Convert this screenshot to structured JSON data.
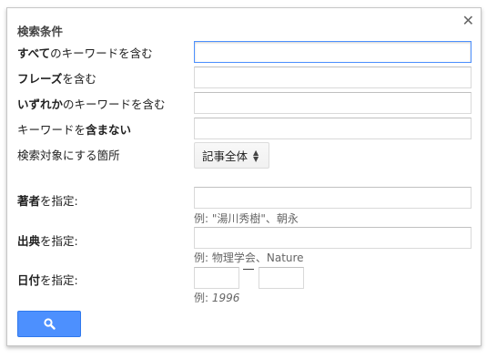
{
  "dialog": {
    "title": "検索条件",
    "close_glyph": "✕"
  },
  "fields": {
    "all_words": {
      "label_bold": "すべて",
      "label_rest": "のキーワードを含む",
      "value": ""
    },
    "phrase": {
      "label_bold": "フレーズ",
      "label_rest": "を含む",
      "value": ""
    },
    "any_words": {
      "label_bold": "いずれか",
      "label_rest": "のキーワードを含む",
      "value": ""
    },
    "exclude": {
      "label_pre": "キーワードを",
      "label_bold": "含まない",
      "value": ""
    },
    "target": {
      "label": "検索対象にする箇所",
      "selected": "記事全体",
      "arrows": "▲▼"
    },
    "author": {
      "label_bold": "著者",
      "label_rest": "を指定:",
      "value": "",
      "example": "例: \"湯川秀樹\"、朝永"
    },
    "source": {
      "label_bold": "出典",
      "label_rest": "を指定:",
      "value": "",
      "example": "例: 物理学会、Nature"
    },
    "date": {
      "label_bold": "日付",
      "label_rest": "を指定:",
      "from": "",
      "to": "",
      "example_prefix": "例: ",
      "example_value": "1996"
    }
  },
  "search_button": {
    "icon": "search-icon"
  },
  "colors": {
    "accent": "#4d90fe",
    "accent_border": "#3079ed",
    "focus_border": "#4d90fe"
  }
}
